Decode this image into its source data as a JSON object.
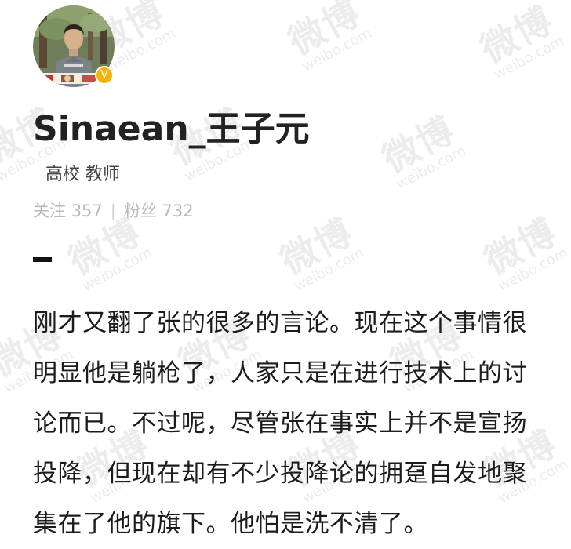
{
  "profile": {
    "name": "Sinaean_王子元",
    "verified_title": "高校 教师",
    "following_label": "关注",
    "following_count": "357",
    "stats_separator": "|",
    "followers_label": "粉丝",
    "followers_count": "732",
    "verified_icon": "verified-v-icon",
    "verified_color": "#f5b400"
  },
  "post": {
    "text": "刚才又翻了张的很多的言论。现在这个事情很明显他是躺枪了，人家只是在进行技术上的讨论而已。不过呢，尽管张在事实上并不是宣扬投降，但现在却有不少投降论的拥趸自发地聚集在了他的旗下。他怕是洗不清了。"
  },
  "watermark": {
    "cn": "微博",
    "en": "weibo.com"
  }
}
